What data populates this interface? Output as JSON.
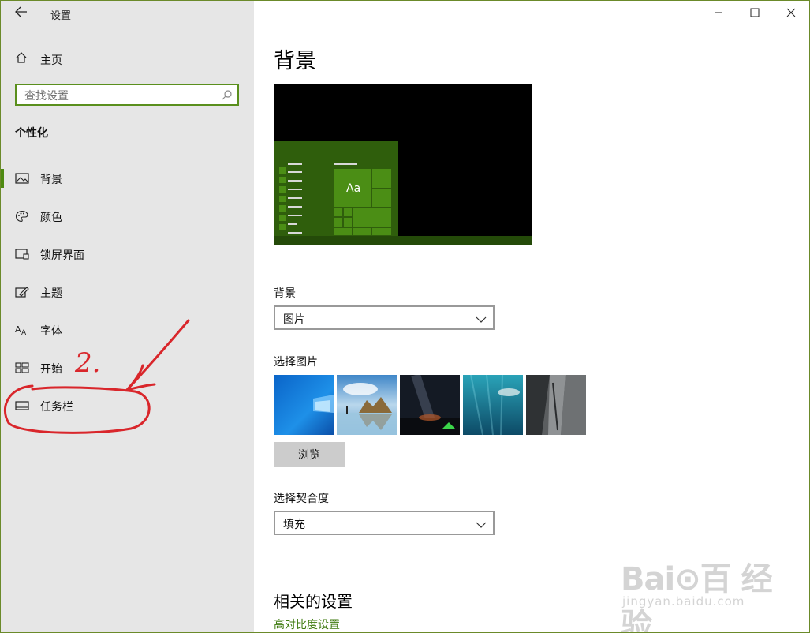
{
  "window": {
    "title": "设置",
    "back_icon": "back-arrow-icon",
    "controls": {
      "minimize": "—",
      "maximize": "☐",
      "close": "✕"
    }
  },
  "sidebar": {
    "home_label": "主页",
    "search_placeholder": "查找设置",
    "section_title": "个性化",
    "items": [
      {
        "label": "背景",
        "icon": "picture-icon",
        "active": true
      },
      {
        "label": "颜色",
        "icon": "palette-icon",
        "active": false
      },
      {
        "label": "锁屏界面",
        "icon": "lock-screen-icon",
        "active": false
      },
      {
        "label": "主题",
        "icon": "theme-icon",
        "active": false
      },
      {
        "label": "字体",
        "icon": "font-icon",
        "active": false
      },
      {
        "label": "开始",
        "icon": "start-icon",
        "active": false
      },
      {
        "label": "任务栏",
        "icon": "taskbar-icon",
        "active": false
      }
    ],
    "annotation": "2."
  },
  "main": {
    "page_title": "背景",
    "preview_tile_text": "Aa",
    "background_label": "背景",
    "background_value": "图片",
    "choose_picture_label": "选择图片",
    "browse_label": "浏览",
    "fit_label": "选择契合度",
    "fit_value": "填充",
    "related_title": "相关的设置",
    "related_link": "高对比度设置"
  },
  "watermark": {
    "logo": "Bai⊙百 经验",
    "sub": "jingyan.baidu.com"
  },
  "colors": {
    "accent": "#4e8a12",
    "link": "#3d7a0e",
    "annotation_red": "#d9262b",
    "sidebar_bg": "#e6e6e6"
  }
}
